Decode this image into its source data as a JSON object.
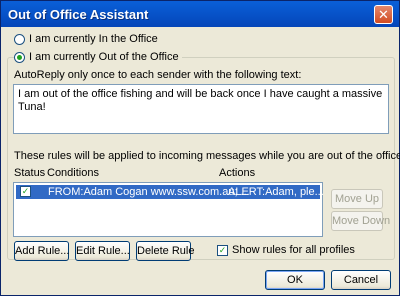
{
  "window": {
    "title": "Out of Office Assistant"
  },
  "status": {
    "in_office_label": "I am currently In the Office",
    "out_office_label": "I am currently Out of the Office"
  },
  "autoreply": {
    "label": "AutoReply only once to each sender with the following text:",
    "text": "I am out of the office fishing and will be back once I have caught a massive Tuna!"
  },
  "rules": {
    "intro": "These rules will be applied to incoming messages while you are out of the office:",
    "columns": {
      "status": "Status",
      "conditions": "Conditions",
      "actions": "Actions"
    },
    "rows": [
      {
        "checked": true,
        "conditions": "FROM:Adam Cogan www.ssw.com.au; ...",
        "actions": "ALERT:Adam, ple..."
      }
    ],
    "move_up": "Move Up",
    "move_down": "Move Down",
    "add_rule": "Add Rule...",
    "edit_rule": "Edit Rule...",
    "delete_rule": "Delete Rule",
    "show_all_profiles": "Show rules for all profiles"
  },
  "footer": {
    "ok": "OK",
    "cancel": "Cancel"
  }
}
